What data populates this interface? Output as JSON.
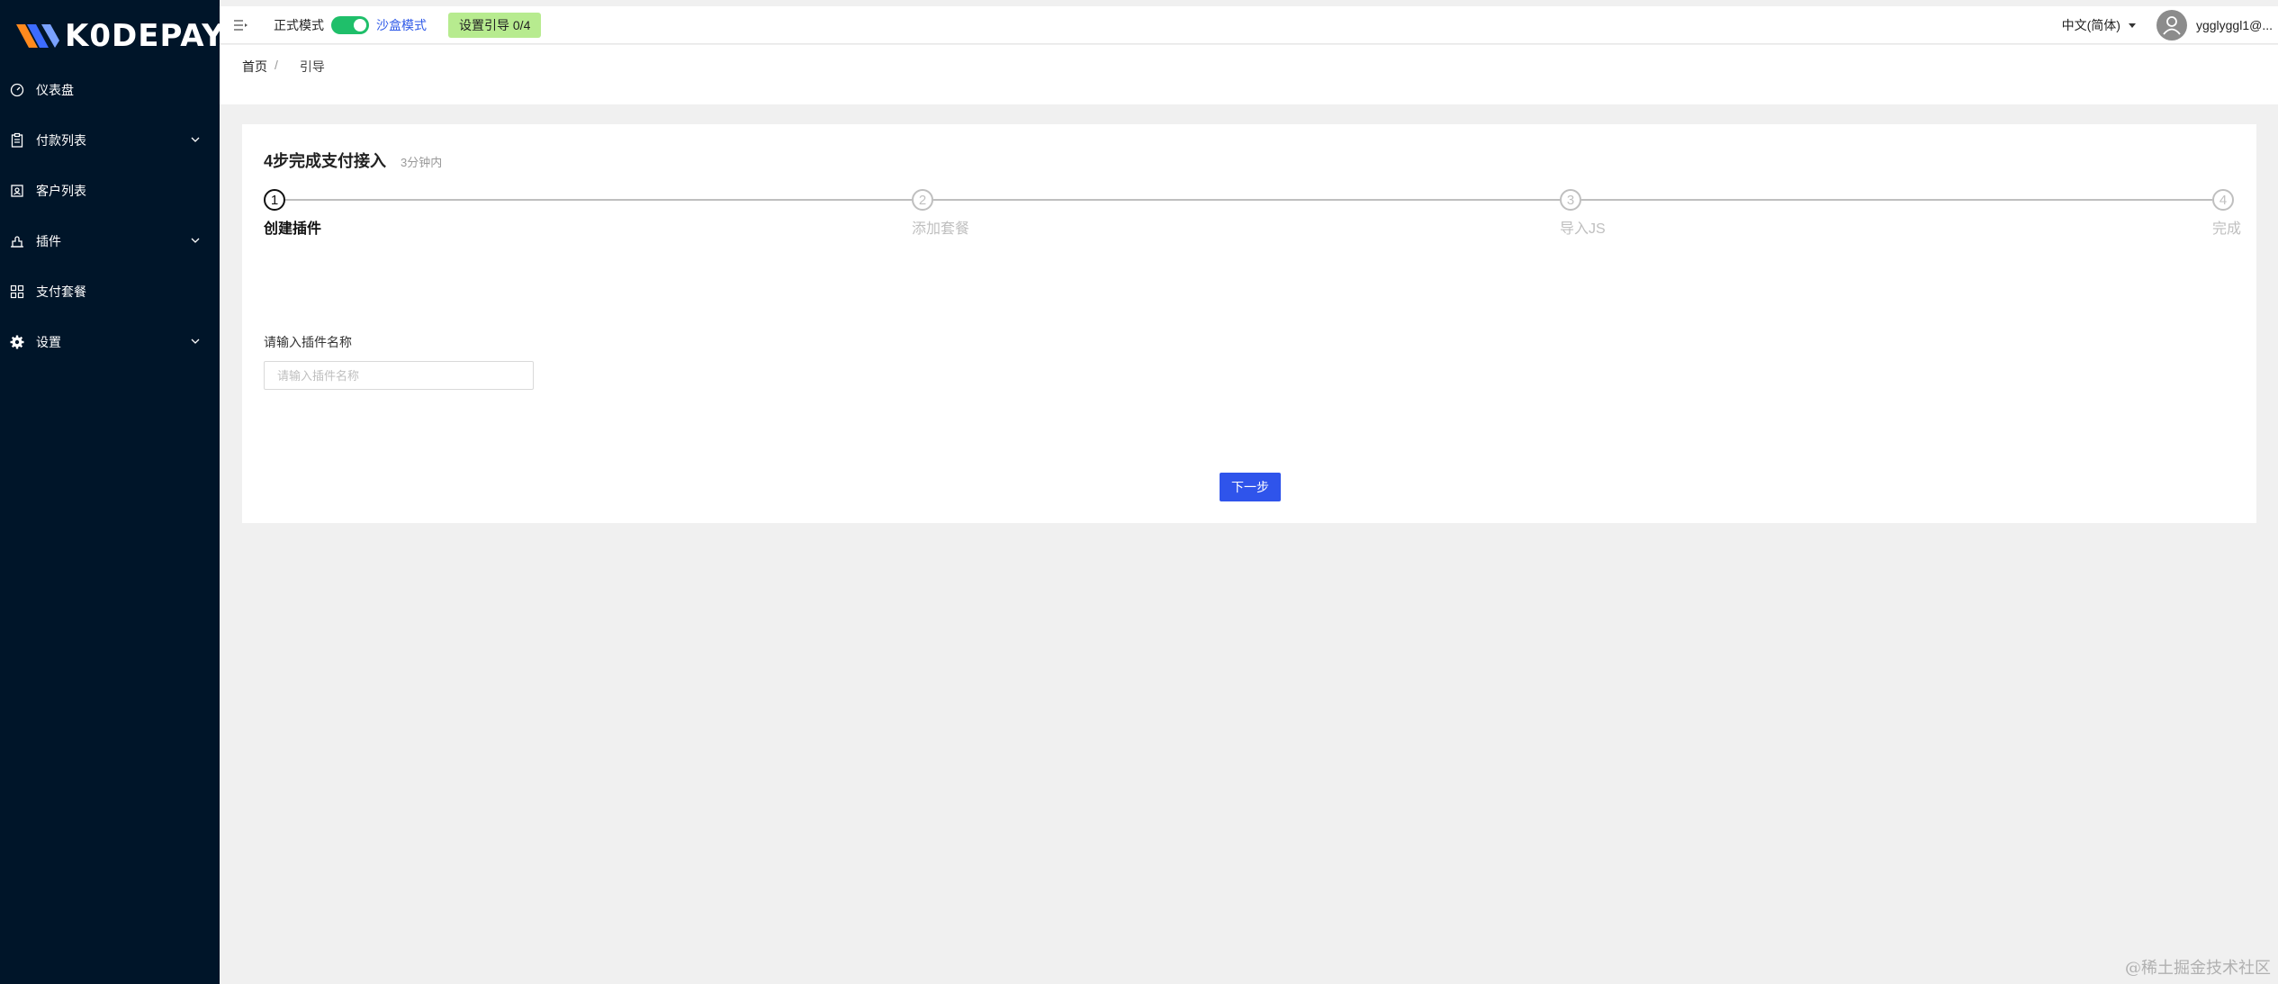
{
  "sidebar": {
    "logo_text": "K0DEPAY",
    "items": [
      {
        "label": "仪表盘",
        "icon": "dashboard-icon",
        "has_arrow": false
      },
      {
        "label": "付款列表",
        "icon": "clipboard-icon",
        "has_arrow": true
      },
      {
        "label": "客户列表",
        "icon": "contacts-icon",
        "has_arrow": false
      },
      {
        "label": "插件",
        "icon": "plugin-icon",
        "has_arrow": true
      },
      {
        "label": "支付套餐",
        "icon": "appstore-icon",
        "has_arrow": false
      },
      {
        "label": "设置",
        "icon": "gear-icon",
        "has_arrow": true
      }
    ]
  },
  "topbar": {
    "live_mode_label": "正式模式",
    "sandbox_mode_label": "沙盒模式",
    "guide_badge": "设置引导 0/4",
    "language": "中文(简体)",
    "username": "ygglyggl1@..."
  },
  "breadcrumb": {
    "home": "首页",
    "separator": "/",
    "current": "引导"
  },
  "card": {
    "title": "4步完成支付接入",
    "subtitle": "3分钟内",
    "steps": [
      {
        "number": "1",
        "label": "创建插件",
        "active": true
      },
      {
        "number": "2",
        "label": "添加套餐",
        "active": false
      },
      {
        "number": "3",
        "label": "导入JS",
        "active": false
      },
      {
        "number": "4",
        "label": "完成",
        "active": false
      }
    ],
    "field_label": "请输入插件名称",
    "field_placeholder": "请输入插件名称",
    "field_value": "",
    "next_button": "下一步"
  },
  "watermark": "@稀土掘金技术社区",
  "colors": {
    "sidebar_bg": "#001529",
    "primary": "#2f54eb",
    "toggle_on": "#1fbf6a",
    "guide_badge_bg": "#b7eb8f"
  }
}
